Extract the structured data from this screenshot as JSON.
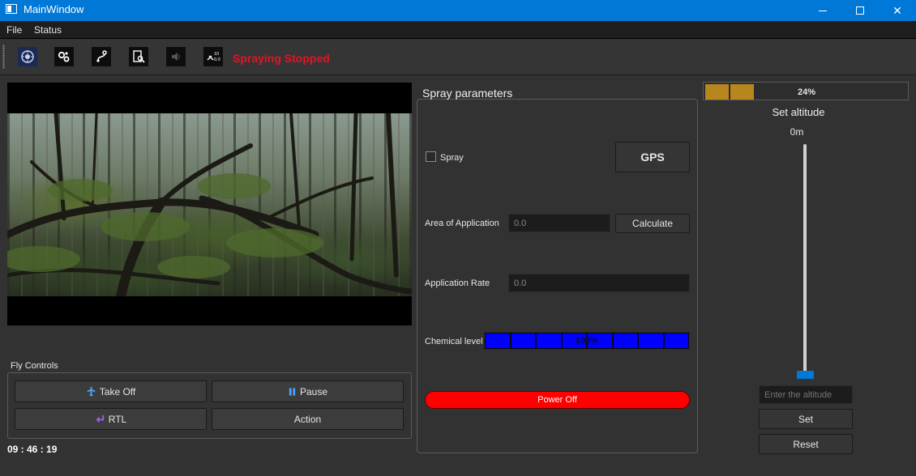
{
  "window": {
    "title": "MainWindow",
    "minimize": "—",
    "maximize": "☐",
    "close": "✕"
  },
  "menu": {
    "items": [
      "File",
      "Status"
    ]
  },
  "toolbar": {
    "tools": [
      "emblem-icon",
      "settings-gears-icon",
      "route-icon",
      "report-search-icon",
      "speaker-icon",
      "coordinates-icon"
    ],
    "status_text": "Spraying Stopped",
    "status_color": "#e81123"
  },
  "video": {
    "description": "forest-camera-feed"
  },
  "fly_controls": {
    "group_label": "Fly Controls",
    "take_off": "Take Off",
    "pause": "Pause",
    "rtl": "RTL",
    "action": "Action",
    "clock": "09 : 46 : 19"
  },
  "spray": {
    "title": "Spray parameters",
    "spray_checkbox_label": "Spray",
    "spray_checked": false,
    "gps_button": "GPS",
    "area_label": "Area of Application",
    "area_placeholder": "0.0",
    "calculate_button": "Calculate",
    "rate_label": "Application Rate",
    "rate_placeholder": "0.0",
    "chemical_label": "Chemical level",
    "chemical_value": "100%",
    "chemical_fraction": 1.0,
    "power_button": "Power Off",
    "power_color": "#ff0000"
  },
  "altitude": {
    "progress_text": "24%",
    "progress_fraction": 0.24,
    "title": "Set altitude",
    "current": "0m",
    "slider_fraction": 0.0,
    "input_placeholder": "Enter the altitude",
    "set_button": "Set",
    "reset_button": "Reset"
  },
  "colors": {
    "accent": "#0078d7",
    "progress_fill": "#b8861e",
    "chemical_fill": "#0000ff"
  }
}
